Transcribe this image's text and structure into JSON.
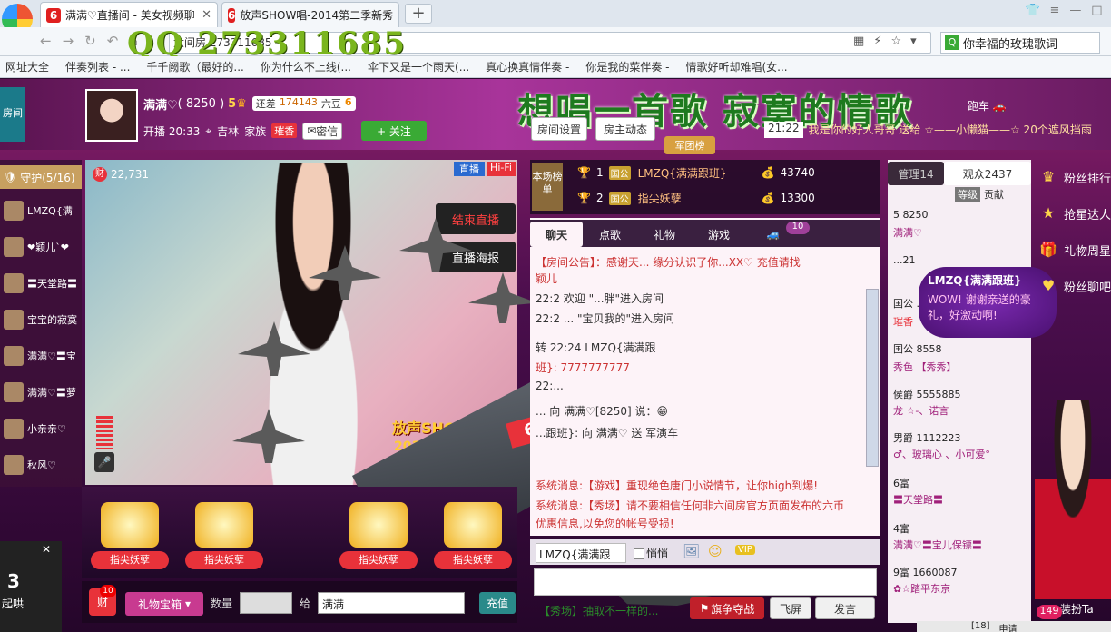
{
  "browser": {
    "tabs": [
      {
        "label": "满满♡直播间 - 美女视频聊",
        "active": true
      },
      {
        "label": "放声SHOW唱-2014第二季新秀",
        "active": false
      }
    ],
    "new_tab": "+",
    "address_text": "六间房 273311685",
    "watermark_qq": "QQ  273311685",
    "search_value": "你幸福的玫瑰歌词",
    "bookmarks": [
      "网址大全",
      "伴奏列表 - ...",
      "千千阙歌（最好的...",
      "你为什么不上线(...",
      "伞下又是一个雨天(...",
      "真心换真情伴奏 -",
      "你是我的菜伴奏 -",
      "情歌好听却难唱(女..."
    ]
  },
  "host": {
    "name": "满满♡",
    "id": "( 8250 )",
    "level": "5",
    "need_label": "还差",
    "need_value": "174143",
    "need_unit": "六豆",
    "next_level": "6",
    "start_time": "开播 20:33",
    "location": "吉林",
    "family_label": "家族",
    "family_badge": "璀香",
    "secret_label": "密信",
    "follow_label": "+ 关注",
    "room_label": "房间"
  },
  "banner": {
    "song_text": "想唱一首歌 寂寞的情歌",
    "marquee_time": "21:22",
    "marquee_text": "我是你的好人哥哥 送给 ☆——小懒猫——☆ 20个遮风挡雨",
    "marquee_top": "跑车"
  },
  "room_buttons": {
    "settings": "房间设置",
    "dynamics": "房主动态",
    "army": "军团榜"
  },
  "guards": {
    "title": "守护(5/16)",
    "items": [
      "LMZQ{满",
      "❤颖儿`❤",
      "〓天堂路〓",
      "宝宝的寂寞",
      "满满♡〓宝",
      "满满♡〓萝",
      "小亲亲♡",
      "秋风♡"
    ]
  },
  "video": {
    "wealth_label": "财",
    "wealth_value": "22,731",
    "live_label": "直播",
    "hifi_label": "Hi-Fi",
    "end_live": "结束直播",
    "poster": "直播海报",
    "overlay_text": "放声SHOW",
    "overlay_year": "2014"
  },
  "gifts": {
    "items": [
      "指尖妖孽",
      "指尖妖孽",
      "指尖妖孽",
      "指尖妖孽"
    ],
    "count_badge": "10",
    "wealth_btn": "财",
    "treasure_label": "礼物宝箱",
    "qty_label": "数量",
    "to_label": "给",
    "to_value": "满满",
    "recharge": "充值"
  },
  "rank": {
    "board_label": "本场榜单",
    "rows": [
      {
        "rank": "1",
        "tag": "国公",
        "name": "LMZQ{满满跟班}",
        "score": "43740"
      },
      {
        "rank": "2",
        "tag": "国公",
        "name": "指尖妖孽",
        "score": "13300"
      }
    ]
  },
  "chat": {
    "tabs": [
      "聊天",
      "点歌",
      "礼物",
      "游戏"
    ],
    "tab_badge": "10",
    "lines": [
      "【房间公告】：感谢天... 缘分认识了你...XX♡ 充值请找",
      "颖儿",
      "22:2  欢迎 \"...胖\"进入房间",
      "22:2  ... \"宝贝我的\"进入房间",
      "转 22:24            LMZQ{满满跟",
      "班}: 7777777777",
      "22:...",
      "      ...  向 满满♡[8250] 说：😁",
      "      ...跟班}: 向 满满♡ 送 军演车",
      "系统消息:【游戏】重现绝色唐门小说情节，让你high到爆!",
      "系统消息:【秀场】请不要相信任何非六间房官方页面发布的六币",
      "优惠信息,以免您的帐号受损!"
    ],
    "target": "LMZQ{满满跟",
    "whisper": "悄悄",
    "vip": "VIP",
    "fly_screen": "飞屏",
    "send": "发言",
    "grab_flag": "旗争夺战",
    "ticker": "【秀场】抽取不一样的..."
  },
  "audience": {
    "admin_tab": "管理14",
    "audience_tab": "观众2437",
    "level_label": "等级",
    "contrib_label": "贡献",
    "rows": [
      {
        "name": "5 8250",
        "sub": "满满♡"
      },
      {
        "name": "...21",
        "sub": ""
      },
      {
        "name": "国公 ...",
        "sub": "璀香"
      },
      {
        "name": "国公 8558",
        "sub": "秀色 【秀秀】"
      },
      {
        "name": "侯爵 5555885",
        "sub": "龙 ☆-、诺言"
      },
      {
        "name": "男爵 1112223",
        "sub": "♂、玻璃心 、小可爱°"
      },
      {
        "name": "6富",
        "sub": "〓天堂路〓"
      },
      {
        "name": "4富",
        "sub": "满满♡〓宝儿保镖〓"
      },
      {
        "name": "9富 1660087",
        "sub": "✿☆踏平东京"
      }
    ],
    "bubble_name": "LMZQ{满满跟班}",
    "bubble_text": "WOW! 谢谢亲送的豪礼，好激动啊!"
  },
  "right_menu": {
    "items": [
      "粉丝排行",
      "抢星达人",
      "礼物周星",
      "粉丝聊吧"
    ],
    "dress_label": "装扮Ta",
    "dress_badge": "149",
    "bottom_count": "[18]",
    "bottom_apply": "申请"
  },
  "bottom_left": {
    "rank_num": "3",
    "rank_label": "起哄"
  },
  "colors": {
    "accent_red": "#e8323a",
    "follow_green": "#3aaa35",
    "gold": "#ffd54a"
  }
}
